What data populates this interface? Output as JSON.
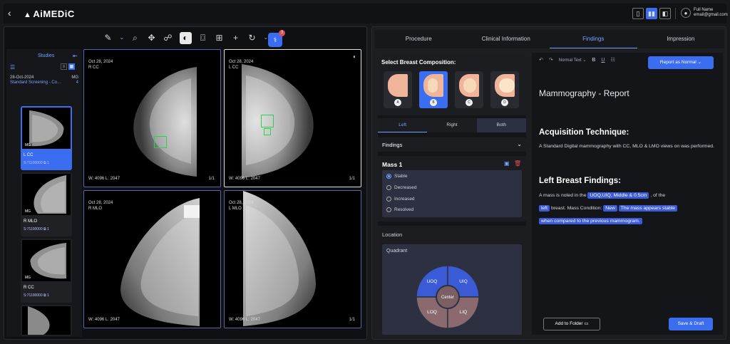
{
  "app": {
    "logo": "AiMEDiC"
  },
  "header": {
    "back_icon": "chevron-left-icon",
    "user_name": "Full Name",
    "user_email": "email@gmail.com"
  },
  "viewer": {
    "notification_count": "3",
    "studies_label": "Studies",
    "study": {
      "date": "28-Oct-2024",
      "modality": "MG",
      "description": "Standard Screening - Co...",
      "count": "4"
    },
    "thumbnails": [
      {
        "tag": "MG",
        "label": "L CC",
        "series": "S:71100000",
        "count": "1"
      },
      {
        "tag": "MG",
        "label": "R MLO",
        "series": "S:71100000",
        "count": "1"
      },
      {
        "tag": "MG",
        "label": "R CC",
        "series": "S:71100000",
        "count": "1"
      }
    ],
    "cells": [
      {
        "date": "Oct 28, 2024",
        "view": "R CC",
        "wl": "W:  4096  L:  2047",
        "page": "1/1"
      },
      {
        "date": "Oct 28, 2024",
        "view": "L CC",
        "wl": "W:  4096  L:  2047",
        "page": "1/1"
      },
      {
        "date": "Oct 28, 2024",
        "view": "R MLO",
        "wl": "W:  4096  L:  2047",
        "page": ""
      },
      {
        "date": "Oct 28, 2024",
        "view": "L MLO",
        "wl": "W:  4096  L:  2047",
        "page": "1/1"
      }
    ]
  },
  "tabs": [
    "Procedure",
    "Clinical Information",
    "Findings",
    "Impression"
  ],
  "findings": {
    "composition_title": "Select Breast Composition:",
    "compositions": [
      "A",
      "B",
      "C",
      "D"
    ],
    "selected_composition": "B",
    "sides": [
      "Left",
      "Right",
      "Both"
    ],
    "findings_label": "Findings",
    "mass_title": "Mass 1",
    "mass_options": [
      "Stable",
      "Decreased",
      "Increased",
      "Resolved"
    ],
    "mass_selected": "Stable",
    "location_label": "Location",
    "quadrant_label": "Quadrant",
    "quadrants": {
      "uoq": "UOQ",
      "uiq": "UIQ",
      "loq": "LOQ",
      "liq": "LIQ",
      "center": "Center"
    }
  },
  "report": {
    "text_style": "Normal Text",
    "report_normal": "Report as Normal",
    "title": "Mammography - Report",
    "acq_heading": "Acquisition Technique:",
    "acq_text": "A Standard Digital mammography with CC, MLO & LMO views on was performed.",
    "left_heading": "Left Breast Findings:",
    "t1": "A mass is noted in the",
    "h1": "UOQ,UIQ, Middle & 0.5cm",
    "t2": ", of the",
    "h2": "left",
    "t3": "breast. Mass Condition:",
    "h3": "New",
    "h4": "The mass appears stable",
    "h5": "when compared to the previous mammogram.",
    "add_folder": "Add to Folder",
    "save": "Save & Draft"
  },
  "colors": {
    "accent": "#3a6df0",
    "roi": "#2bd24b"
  }
}
